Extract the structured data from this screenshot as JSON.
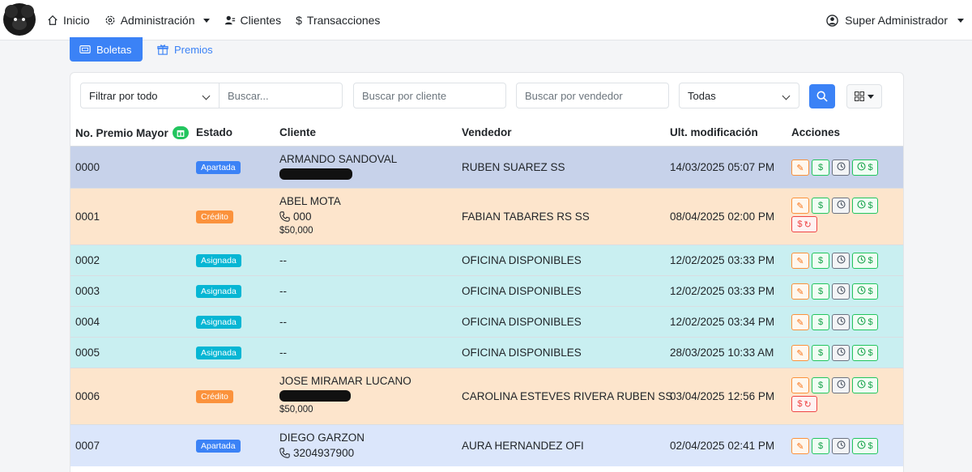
{
  "nav": {
    "items": [
      {
        "label": "Inicio",
        "icon": "home-icon"
      },
      {
        "label": "Administración",
        "icon": "gear-icon"
      },
      {
        "label": "Clientes",
        "icon": "users-icon"
      },
      {
        "label": "Transacciones",
        "icon": "dollar-icon"
      }
    ],
    "user": "Super Administrador"
  },
  "tabs": [
    {
      "label": "Boletas",
      "icon": "ticket-icon"
    },
    {
      "label": "Premios",
      "icon": "gift-icon"
    }
  ],
  "filters": {
    "filter_select": "Filtrar por todo",
    "search_placeholder": "Buscar...",
    "client_placeholder": "Buscar por cliente",
    "seller_placeholder": "Buscar por vendedor",
    "status_select": "Todas"
  },
  "columns": {
    "number": "No. Premio Mayor",
    "status": "Estado",
    "client": "Cliente",
    "seller": "Vendedor",
    "modified": "Ult. modificación",
    "actions": "Acciones"
  },
  "colors": {
    "apartada_row": "#c7d2ea",
    "apartada_row_light": "#dbe6fb",
    "credito_row": "#fde5cc",
    "asignada_row": "#c9eff1"
  },
  "rows": [
    {
      "number": "0000",
      "status": "Apartada",
      "client": "ARMANDO SANDOVAL",
      "phone": "",
      "amount": "",
      "seller": "RUBEN SUAREZ SS",
      "modified": "14/03/2025 05:07 PM"
    },
    {
      "number": "0001",
      "status": "Crédito",
      "client": "ABEL MOTA",
      "phone": "000",
      "amount": "$50,000",
      "seller": "FABIAN TABARES RS SS",
      "modified": "08/04/2025 02:00 PM"
    },
    {
      "number": "0002",
      "status": "Asignada",
      "client": "--",
      "phone": "",
      "amount": "",
      "seller": "OFICINA DISPONIBLES",
      "modified": "12/02/2025 03:33 PM"
    },
    {
      "number": "0003",
      "status": "Asignada",
      "client": "--",
      "phone": "",
      "amount": "",
      "seller": "OFICINA DISPONIBLES",
      "modified": "12/02/2025 03:33 PM"
    },
    {
      "number": "0004",
      "status": "Asignada",
      "client": "--",
      "phone": "",
      "amount": "",
      "seller": "OFICINA DISPONIBLES",
      "modified": "12/02/2025 03:34 PM"
    },
    {
      "number": "0005",
      "status": "Asignada",
      "client": "--",
      "phone": "",
      "amount": "",
      "seller": "OFICINA DISPONIBLES",
      "modified": "28/03/2025 10:33 AM"
    },
    {
      "number": "0006",
      "status": "Crédito",
      "client": "JOSE MIRAMAR LUCANO",
      "phone": "",
      "amount": "$50,000",
      "seller": "CAROLINA ESTEVES RIVERA RUBEN SS",
      "modified": "03/04/2025 12:56 PM"
    },
    {
      "number": "0007",
      "status": "Apartada",
      "client": "DIEGO GARZON",
      "phone": "3204937900",
      "amount": "",
      "seller": "AURA HERNANDEZ OFI",
      "modified": "02/04/2025 02:41 PM"
    }
  ]
}
